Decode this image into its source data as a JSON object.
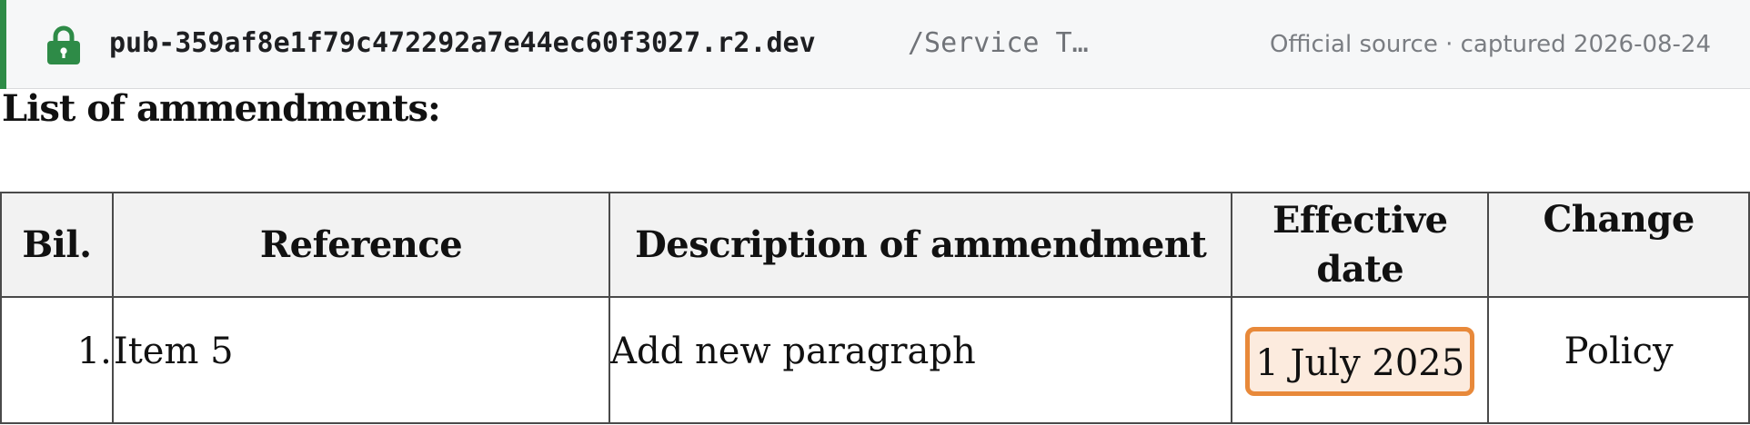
{
  "toolbar": {
    "domain": "pub-359af8e1f79c472292a7e44ec60f3027.r2.dev",
    "path": "/Service T…",
    "source_note": "Official source · captured 2026-08-24",
    "lock_icon": "lock-icon",
    "accent_color": "#2e8b47"
  },
  "document": {
    "heading": "List of ammendments:",
    "table": {
      "headers": {
        "bil": "Bil.",
        "reference": "Reference",
        "description": "Description of ammendment",
        "effective_line1": "Effective",
        "effective_line2": "date",
        "change": "Change"
      },
      "rows": [
        {
          "bil": "1.",
          "reference": "Item 5",
          "description": "Add new paragraph",
          "effective_date": "1 July 2025",
          "change": "Policy"
        }
      ]
    },
    "highlight_color": "#e8893a"
  }
}
